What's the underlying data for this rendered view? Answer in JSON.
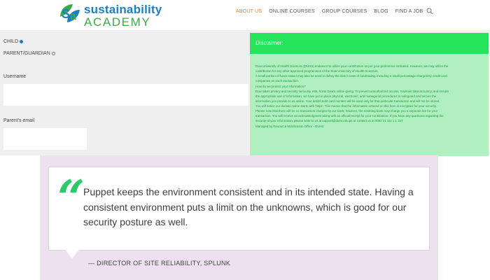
{
  "header": {
    "logo": {
      "top": "sustainability",
      "bottom": "ACADEMY"
    },
    "nav": [
      {
        "label": "ABOUT US",
        "active": true
      },
      {
        "label": "ONLINE COURSES",
        "active": false
      },
      {
        "label": "GROUP COURSES",
        "active": false
      },
      {
        "label": "BLOG",
        "active": false
      },
      {
        "label": "FIND A JOB",
        "active": false
      }
    ],
    "icons": {
      "search": "search-icon",
      "cart": "shopping-bag-icon"
    }
  },
  "form": {
    "child_label": "CHILD",
    "parent_label": "PARENT/GUARDIAN",
    "username_label": "Username",
    "username_value": "",
    "email_label": "Parent's email",
    "email_value": ""
  },
  "disclaimer": {
    "title": "Disclaimer:",
    "lines": [
      "Dow University of Health Sciences (DUHS) endeavor to utilize your contribution as per your preference indicated. However, we may utilize the",
      "contribution for any other approved programmes of the Dow University of Health Sciences.",
      "A small portion of funds raised may also be used in defray the direct costs of fundraising, including a small percentage charged by credit card",
      "companies on each transaction.",
      "How do we protect your information?",
      "Dow takes privacy and security seriously. HBL hosts Dow's online giving. To prevent unauthorized access, maintain data accuracy, and ensure",
      "the appropriate use of information, we have put in place physical, electronic, and managerial procedures to safeguard and secure the",
      "information you provide to us online. Your debit/credit card number will be used only for that particular transaction and will not be stored.",
      "You will notice our domain name starts with 'https'. This means that the information entered on this form is encrypted for your security.",
      "Please note that there will be no transaction charges by our bank; however, the remitting bank may charge you a separate fee for your",
      "transaction. You will receive an acknowledgment along with an official receipt for your contribution. If you have any questions regarding the",
      "security of your information, please write to us at support@duhs.edu.pk or contact us at 0092 21 111 1 1 347",
      "Managed by Resource Mobilization Office - DUHS"
    ]
  },
  "testimonial": {
    "quote": "Puppet keeps the environment consistent and in its intended state. Having a consistent environment puts a limit on the unknowns, which is good for our security posture as well.",
    "author": "— DIRECTOR OF SITE RELIABILITY, SPLUNK",
    "accent_color": "#2fc86a"
  }
}
